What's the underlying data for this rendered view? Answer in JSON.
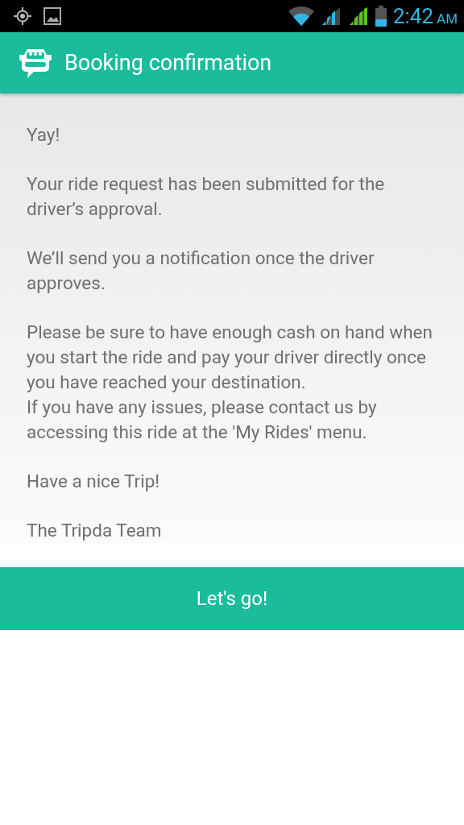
{
  "status_bar": {
    "time": "2:42",
    "meridiem": "AM"
  },
  "app_bar": {
    "title": "Booking confirmation"
  },
  "message": {
    "paragraphs": [
      [
        "Yay!"
      ],
      [
        "Your ride request has been submitted for the driver’s approval."
      ],
      [
        "We’ll send you a notification once the driver approves."
      ],
      [
        "Please be sure to have enough cash on hand when you start the ride and pay your driver directly once you have reached your destination.",
        "If you have any issues, please contact us by accessing this ride at the 'My Rides' menu."
      ],
      [
        "Have a nice Trip!"
      ],
      [
        "The Tripda Team"
      ]
    ]
  },
  "footer_button": {
    "label": "Let's go!"
  }
}
